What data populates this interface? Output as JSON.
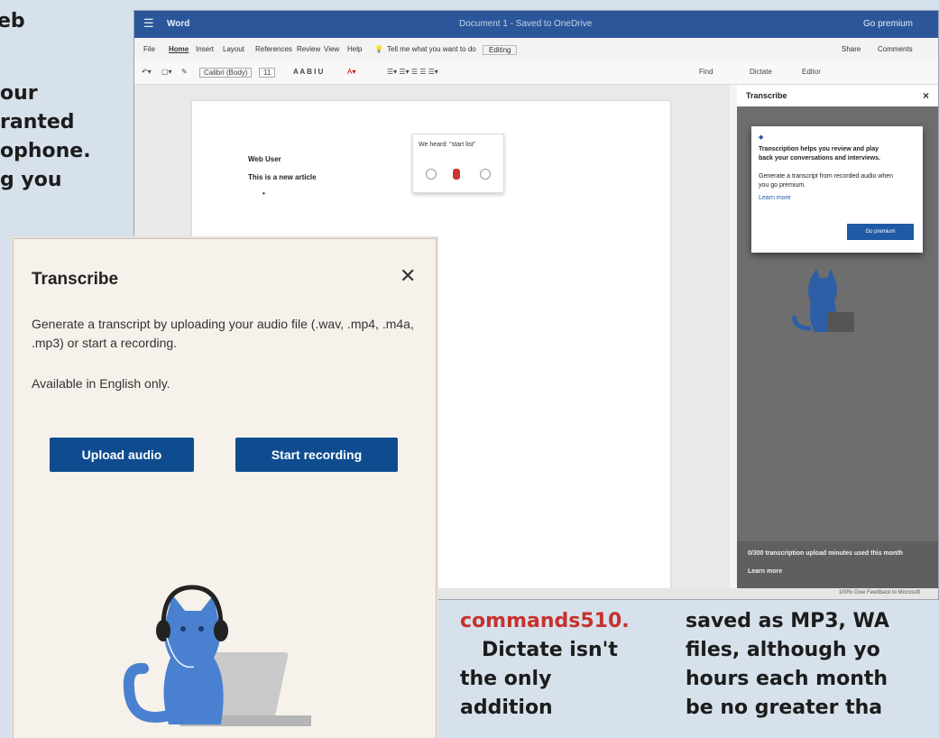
{
  "article_left": [
    "eb",
    "",
    "our",
    "ranted",
    "ophone.",
    "g you"
  ],
  "word": {
    "title_app": "Word",
    "title_doc": "Document 1 - Saved to OneDrive",
    "title_user": "Go premium",
    "menu": [
      "File",
      "Home",
      "Insert",
      "Layout",
      "References",
      "Review",
      "View",
      "Help"
    ],
    "tell_me": "Tell me what you want to do",
    "editing": "Editing",
    "share": "Share",
    "comments": "Comments",
    "font_name": "Calibri (Body)",
    "font_size": "11",
    "find": "Find",
    "dictate": "Dictate",
    "editor": "Editor",
    "doc_line1": "Web User",
    "doc_line2": "This is a new article",
    "heard_label": "We heard: \"start list\"",
    "side_title": "Transcribe",
    "tip_lines": [
      "Transcription helps you review and play",
      "back your conversations and interviews.",
      "",
      "Generate a transcript from recorded audio when",
      "you go premium.",
      "Learn more"
    ],
    "tip_button": "Go premium",
    "side_foot1": "0/300 transcription upload minutes used this month",
    "side_foot2": "Learn more",
    "status": "100%   Give Feedback to Microsoft"
  },
  "transcribe": {
    "title": "Transcribe",
    "description": "Generate a transcript by uploading your audio file (.wav, .mp4, .m4a, .mp3) or start a recording.",
    "availability": "Available in English only.",
    "upload_label": "Upload audio",
    "record_label": "Start recording"
  },
  "article_bottom": {
    "col1": [
      "commands510.",
      "Dictate isn't",
      "the only",
      "addition"
    ],
    "col2": [
      "saved as MP3, WA",
      "files, although yo",
      "hours each month",
      "be no greater tha"
    ]
  },
  "colors": {
    "accent": "#0f4c8f",
    "word_blue": "#2b579a",
    "link_red": "#c8312c"
  }
}
